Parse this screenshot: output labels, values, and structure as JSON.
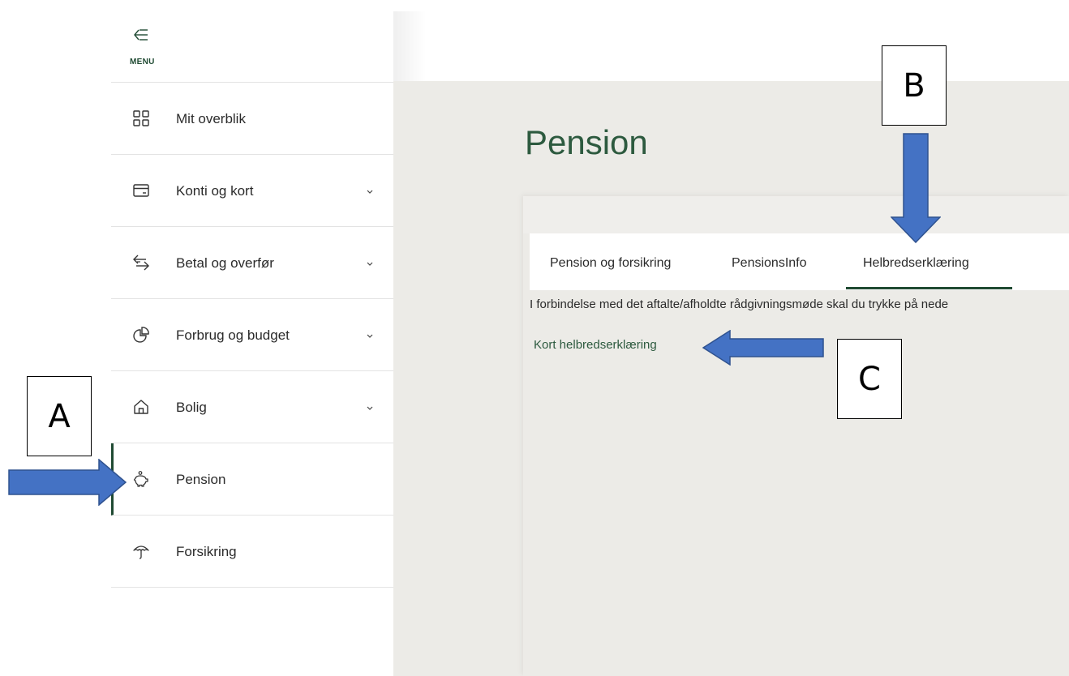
{
  "sidebar": {
    "menu_label": "MENU",
    "items": [
      {
        "label": "Mit overblik",
        "icon": "grid-icon",
        "has_chevron": false
      },
      {
        "label": "Konti og kort",
        "icon": "card-icon",
        "has_chevron": true
      },
      {
        "label": "Betal og overfør",
        "icon": "transfer-icon",
        "has_chevron": true
      },
      {
        "label": "Forbrug og budget",
        "icon": "pie-chart-icon",
        "has_chevron": true
      },
      {
        "label": "Bolig",
        "icon": "house-icon",
        "has_chevron": true
      },
      {
        "label": "Pension",
        "icon": "piggy-bank-icon",
        "has_chevron": false,
        "active": true
      },
      {
        "label": "Forsikring",
        "icon": "umbrella-icon",
        "has_chevron": false
      }
    ]
  },
  "main": {
    "title": "Pension",
    "tabs": [
      {
        "label": "Pension og forsikring"
      },
      {
        "label": "PensionsInfo"
      },
      {
        "label": "Helbredserklæring",
        "active": true
      }
    ],
    "intro_text": "I forbindelse med det aftalte/afholdte rådgivningsmøde skal du trykke på nede",
    "link_text": "Kort helbredserklæring"
  },
  "annotations": {
    "a": "A",
    "b": "B",
    "c": "C",
    "arrow_color": "#4472c4"
  },
  "colors": {
    "brand_green": "#1f4a32",
    "title_green": "#2d5a3f",
    "main_bg": "#ecebe7"
  }
}
